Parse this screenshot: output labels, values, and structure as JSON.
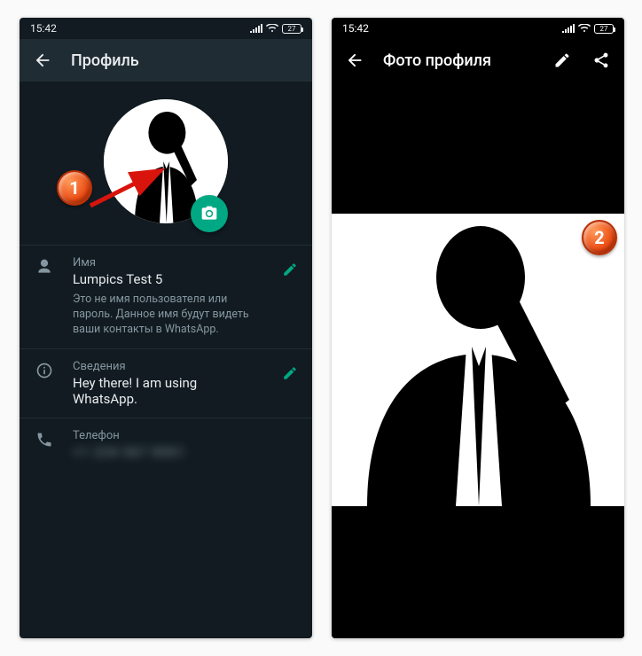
{
  "status": {
    "time": "15:42",
    "battery": "27"
  },
  "left": {
    "title": "Профиль",
    "name_label": "Имя",
    "name_value": "Lumpics Test 5",
    "name_desc": "Это не имя пользователя или пароль. Данное имя будут видеть ваши контакты в WhatsApp.",
    "about_label": "Сведения",
    "about_value": "Hey there! I am using WhatsApp.",
    "phone_label": "Телефон",
    "phone_value": "+1 234 567 8901"
  },
  "right": {
    "title": "Фото профиля"
  },
  "annotations": {
    "badge1": "1",
    "badge2": "2"
  },
  "colors": {
    "accent": "#00a884",
    "dark_bg": "#111b21",
    "appbar_bg": "#202c33"
  }
}
